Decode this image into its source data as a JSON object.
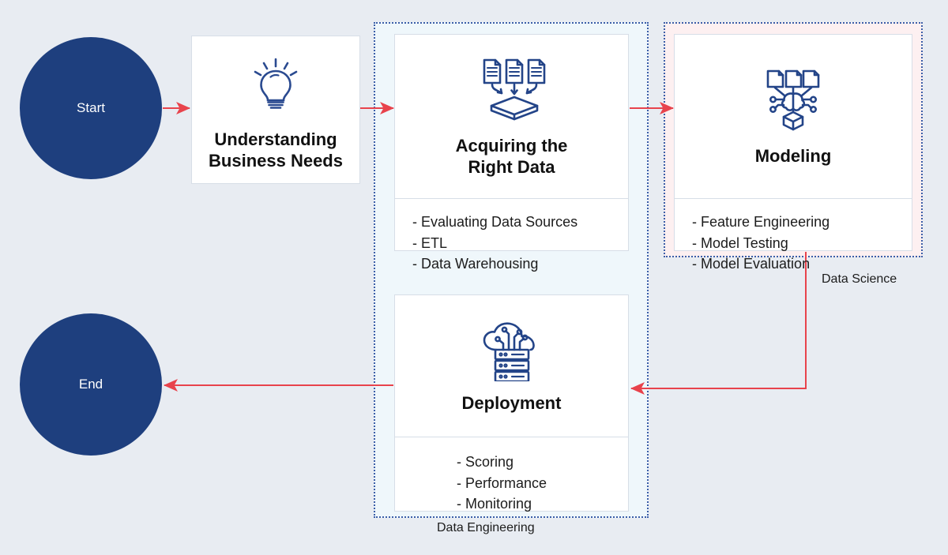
{
  "diagram": {
    "background_color": "#e8ecf2",
    "accent_navy": "#1e3f7e",
    "accent_red": "#e8434c",
    "icon_color": "#234488"
  },
  "nodes": {
    "start": {
      "label": "Start"
    },
    "end": {
      "label": "End"
    }
  },
  "steps": [
    {
      "id": "understanding-business-needs",
      "title": "Understanding\nBusiness Needs",
      "title_line1": "Understanding",
      "title_line2": "Business Needs",
      "icon": "lightbulb-icon",
      "items": []
    },
    {
      "id": "acquiring-the-right-data",
      "title_line1": "Acquiring the",
      "title_line2": "Right Data",
      "icon": "documents-to-platform-icon",
      "items": [
        "- Evaluating Data Sources",
        "- ETL",
        "- Data Warehousing"
      ]
    },
    {
      "id": "modeling",
      "title_line1": "Modeling",
      "title_line2": "",
      "icon": "neural-network-icon",
      "items": [
        "- Feature Engineering",
        "- Model Testing",
        "- Model Evaluation"
      ]
    },
    {
      "id": "deployment",
      "title_line1": "Deployment",
      "title_line2": "",
      "icon": "cloud-server-icon",
      "items": [
        "- Scoring",
        "- Performance",
        "- Monitoring"
      ]
    }
  ],
  "groups": {
    "data_engineering": {
      "label": "Data Engineering",
      "fill": "#eff7fb",
      "border": "#3b5ea8"
    },
    "data_science": {
      "label": "Data Science",
      "fill": "#fdf0f1",
      "border": "#3b5ea8"
    }
  },
  "connectors": [
    {
      "name": "start-to-understanding",
      "direction": "right"
    },
    {
      "name": "understanding-to-acquiring",
      "direction": "right"
    },
    {
      "name": "acquiring-to-modeling",
      "direction": "right"
    },
    {
      "name": "modeling-to-deployment",
      "direction": "down-then-left"
    },
    {
      "name": "deployment-to-end",
      "direction": "left"
    }
  ]
}
